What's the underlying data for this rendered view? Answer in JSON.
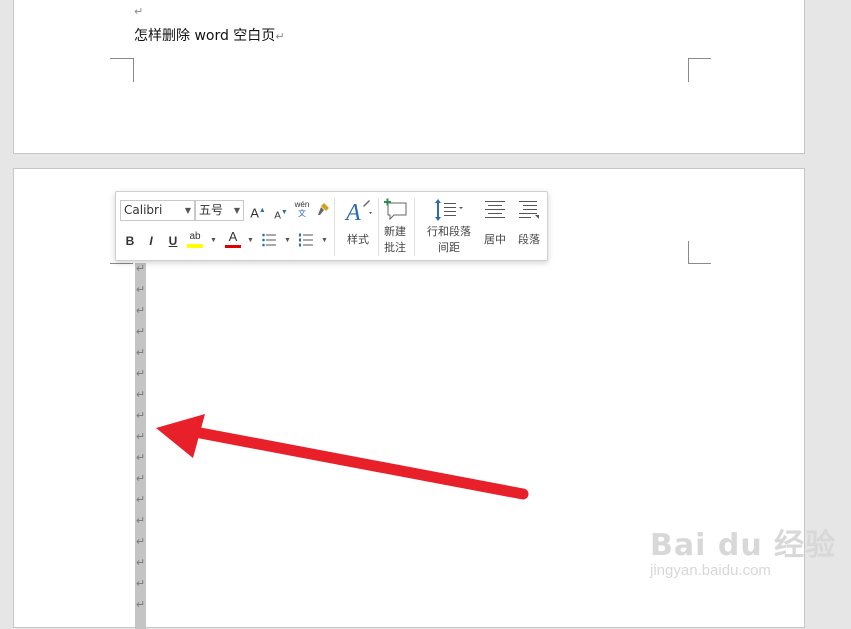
{
  "document": {
    "title_line": "怎样删除 word 空白页",
    "paragraph_mark": "↵"
  },
  "mini_toolbar": {
    "font_name": "Calibri",
    "font_size": "五号",
    "grow_font": "A",
    "shrink_font": "A",
    "phonetic": "wén",
    "phonetic_char": "文",
    "bold": "B",
    "italic": "I",
    "underline": "U",
    "highlight_label": "ab",
    "font_color_label": "A",
    "styles_label": "样式",
    "new_comment_line1": "新建",
    "new_comment_line2": "批注",
    "spacing_line1": "行和段落",
    "spacing_line2": "间距",
    "center_label": "居中",
    "paragraph_label": "段落"
  },
  "colors": {
    "highlight": "#ffff00",
    "font_color": "#e00000",
    "arrow": "#e8202a",
    "accent": "#2b6cb0"
  },
  "watermark": {
    "brand": "Bai du 经验",
    "site": "jingyan.baidu.com"
  }
}
